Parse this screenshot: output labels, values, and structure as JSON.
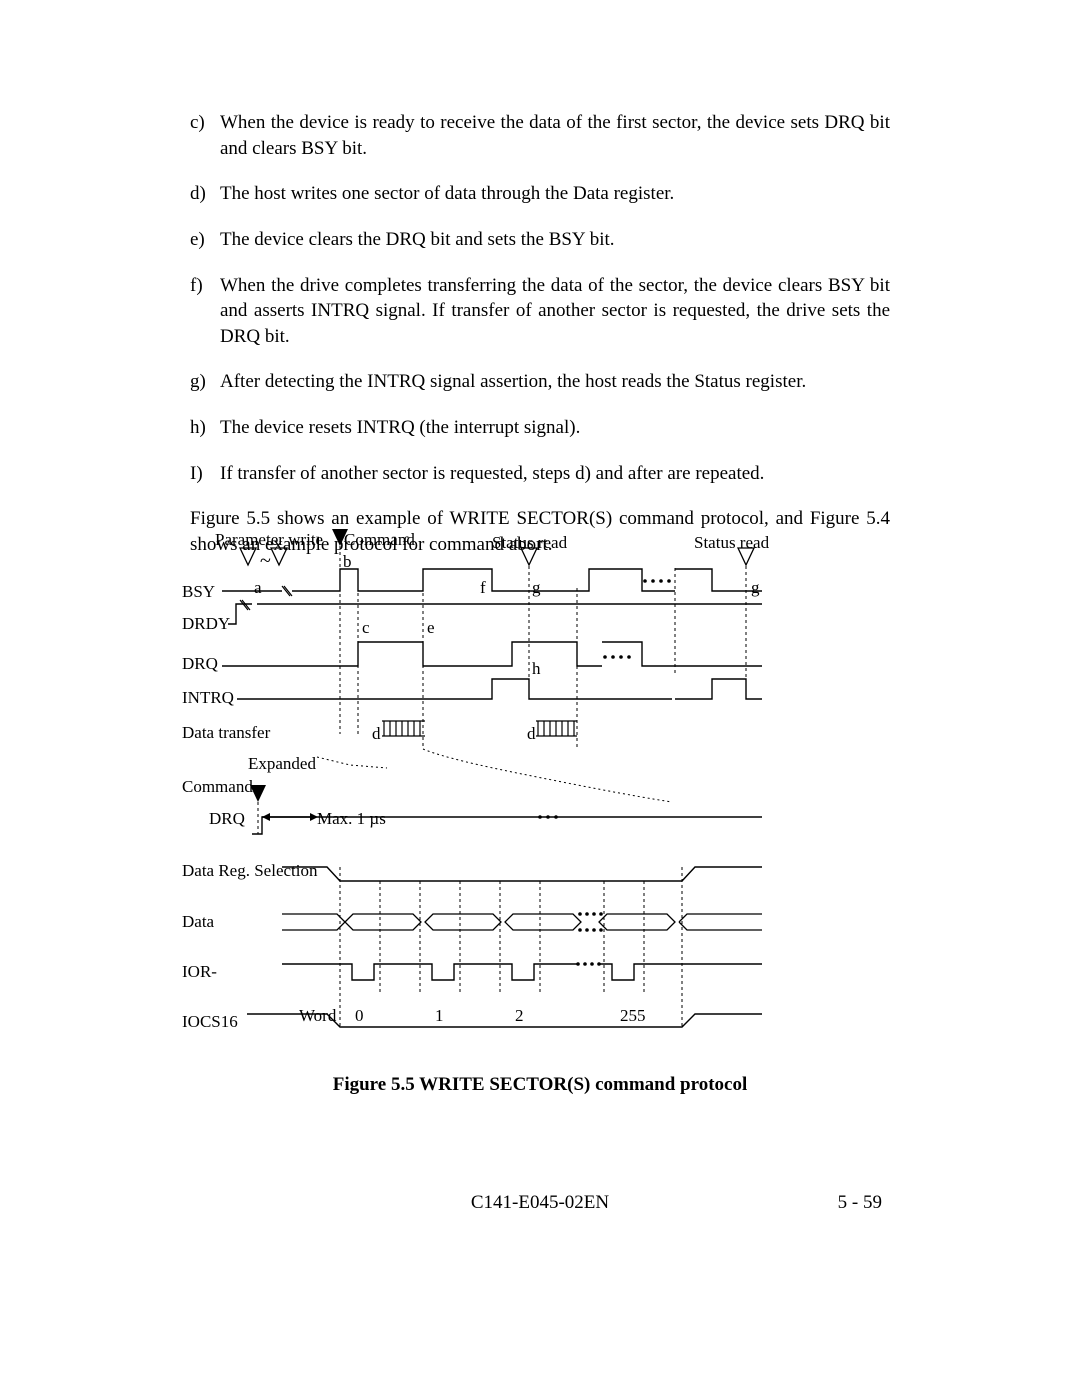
{
  "list": {
    "c": {
      "label": "c)",
      "text": "When the device is ready to receive the data of the first sector, the device sets DRQ bit and clears BSY bit."
    },
    "d": {
      "label": "d)",
      "text": "The host writes one sector of data through the Data register."
    },
    "e": {
      "label": "e)",
      "text": "The device clears the DRQ bit and sets the BSY bit."
    },
    "f": {
      "label": "f)",
      "text": "When the drive completes transferring the data of the sector, the device clears BSY bit and asserts INTRQ signal.  If transfer of another sector is requested, the drive sets the DRQ bit."
    },
    "g": {
      "label": "g)",
      "text": "After detecting the INTRQ signal assertion, the host reads the Status register."
    },
    "h": {
      "label": "h)",
      "text": "The device resets INTRQ (the interrupt signal)."
    },
    "i": {
      "label": "I)",
      "text": "If transfer of another sector is requested, steps d) and after are repeated."
    }
  },
  "para": "Figure 5.5 shows an example of WRITE SECTOR(S) command protocol, and Figure 5.4 shows an example protocol for command abort.",
  "caption": "Figure 5.5    WRITE SECTOR(S) command protocol",
  "footer": {
    "center": "C141-E045-02EN",
    "right": "5 - 59"
  },
  "diagram": {
    "parameter_write": "Parameter write",
    "command": "Command",
    "status_read1": "Status read",
    "status_read2": "Status read",
    "bsy": "BSY",
    "drdy": "DRDY",
    "drq_top": "DRQ",
    "intrq": "INTRQ",
    "data_transfer": "Data transfer",
    "expanded": "Expanded",
    "command2": "Command",
    "drq_bot": "DRQ",
    "max": "Max. 1 µs",
    "data_reg_sel": "Data Reg. Selection",
    "data": "Data",
    "ior": "IOR-",
    "iocs16": "IOCS16",
    "word": "Word",
    "a": "a",
    "b": "b",
    "c": "c",
    "d": "d",
    "e": "e",
    "f": "f",
    "g": "g",
    "h": "h",
    "w0": "0",
    "w1": "1",
    "w2": "2",
    "w255": "255",
    "tilde": "~"
  }
}
